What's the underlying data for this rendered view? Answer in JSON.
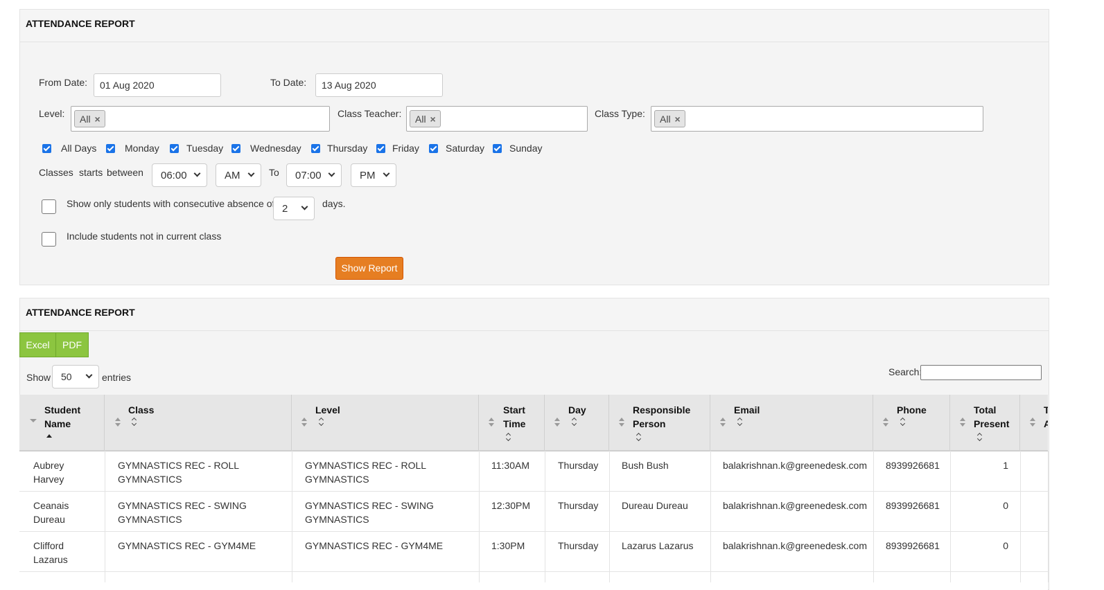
{
  "filter_panel": {
    "title": "ATTENDANCE REPORT",
    "from_date_label": "From Date:",
    "from_date_value": "01 Aug 2020",
    "to_date_label": "To Date:",
    "to_date_value": "13 Aug 2020",
    "level_label": "Level:",
    "level_chip": "All",
    "class_teacher_label": "Class Teacher:",
    "class_teacher_chip": "All",
    "class_type_label": "Class Type:",
    "class_type_chip": "All",
    "days": [
      "All Days",
      "Monday",
      "Tuesday",
      "Wednesday",
      "Thursday",
      "Friday",
      "Saturday",
      "Sunday"
    ],
    "classes_label": "Classes",
    "starts_label": "starts",
    "between_label": "between",
    "start_time": "06:00",
    "start_ampm": "AM",
    "to_label": "To",
    "end_time": "07:00",
    "end_ampm": "PM",
    "consecutive_label": "Show only students with consecutive absence of",
    "consecutive_value": "2",
    "days_suffix": "days.",
    "include_label": "Include students not in current class",
    "show_report_button": "Show Report"
  },
  "report_panel": {
    "title": "ATTENDANCE REPORT",
    "excel_button": "Excel",
    "pdf_button": "PDF",
    "show_label": "Show",
    "entries_value": "50",
    "entries_label": "entries",
    "search_label": "Search:",
    "search_value": "",
    "columns": {
      "student_name": [
        "Student",
        "Name"
      ],
      "class": "Class",
      "level": "Level",
      "start_time": [
        "Start",
        "Time"
      ],
      "day": "Day",
      "responsible_person": [
        "Responsible",
        "Person"
      ],
      "email": "Email",
      "phone": "Phone",
      "total_present": [
        "Total",
        "Present"
      ],
      "total_absent_cut": [
        "T",
        "A"
      ]
    },
    "rows": [
      {
        "student": [
          "Aubrey",
          "Harvey"
        ],
        "class": [
          "GYMNASTICS REC - ROLL",
          "GYMNASTICS"
        ],
        "level": [
          "GYMNASTICS REC - ROLL",
          "GYMNASTICS"
        ],
        "start_time": "11:30AM",
        "day": "Thursday",
        "responsible": "Bush Bush",
        "email": "balakrishnan.k@greenedesk.com",
        "phone": "8939926681",
        "present": "1"
      },
      {
        "student": [
          "Ceanais",
          "Dureau"
        ],
        "class": [
          "GYMNASTICS REC - SWING",
          "GYMNASTICS"
        ],
        "level": [
          "GYMNASTICS REC - SWING",
          "GYMNASTICS"
        ],
        "start_time": "12:30PM",
        "day": "Thursday",
        "responsible": "Dureau Dureau",
        "email": "balakrishnan.k@greenedesk.com",
        "phone": "8939926681",
        "present": "0"
      },
      {
        "student": [
          "Clifford",
          "Lazarus"
        ],
        "class": [
          "GYMNASTICS REC - GYM4ME",
          ""
        ],
        "level": [
          "GYMNASTICS REC - GYM4ME",
          ""
        ],
        "start_time": "1:30PM",
        "day": "Thursday",
        "responsible": "Lazarus Lazarus",
        "email": "balakrishnan.k@greenedesk.com",
        "phone": "8939926681",
        "present": "0"
      }
    ]
  },
  "colors": {
    "accent_orange": "#e67e22",
    "export_green": "#8cc540",
    "checkbox_blue": "#1a73e8"
  }
}
